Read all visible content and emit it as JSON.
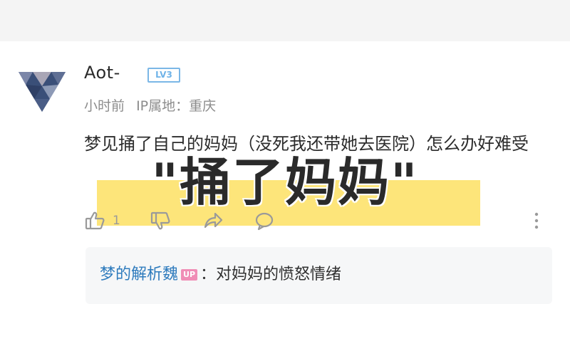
{
  "comment": {
    "username": "Aot-",
    "level_badge": "LV3",
    "time": "小时前",
    "ip_location": "IP属地：重庆",
    "text": "梦见捅了自己的妈妈（没死我还带她去医院）怎么办好难受",
    "overlay_title": "\"捅了妈妈\"",
    "like_count": "1",
    "highlight_color": "#fde57a"
  },
  "reply": {
    "author": "梦的解析魏",
    "badge": "UP",
    "separator": "：",
    "text": "对妈妈的愤怒情绪",
    "author_color": "#2e7bbd",
    "badge_color": "#f08db6"
  },
  "icons": {
    "avatar": "geometric-diamond-avatar",
    "like": "thumbs-up-icon",
    "dislike": "thumbs-down-icon",
    "share": "share-icon",
    "reply": "comment-icon",
    "more": "more-vertical-icon"
  }
}
